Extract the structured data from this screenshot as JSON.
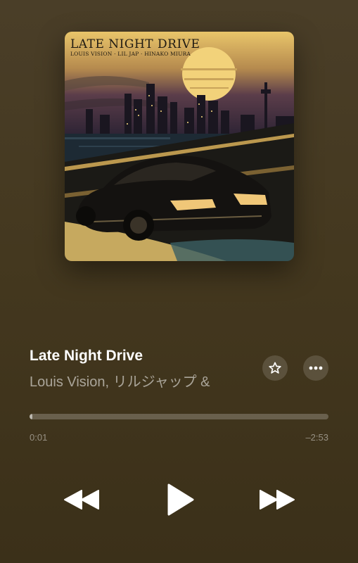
{
  "artwork": {
    "title": "LATE NIGHT DRIVE",
    "credits": "LOUIS VISION · LIL JAP · HINAKO MIURA"
  },
  "track": {
    "title": "Late Night Drive",
    "artist": "Louis Vision, リルジャップ &"
  },
  "actions": {
    "favorite_icon": "star-icon",
    "more_icon": "ellipsis-icon"
  },
  "playback": {
    "elapsed": "0:01",
    "remaining": "–2:53",
    "progress": 0.006
  },
  "controls": {
    "previous_icon": "rewind-icon",
    "play_icon": "play-icon",
    "next_icon": "fast-forward-icon"
  },
  "colors": {
    "background": "#44381f",
    "accent_moon": "#f2d27a"
  }
}
